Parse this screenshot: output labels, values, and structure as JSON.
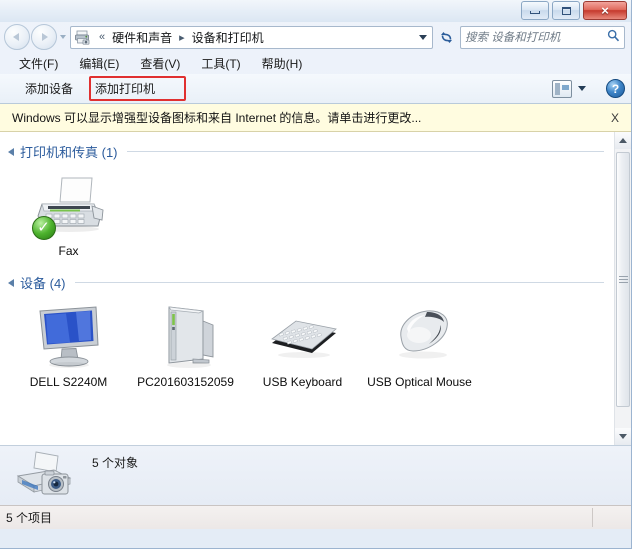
{
  "window": {
    "controls": {
      "minimize": "Minimize",
      "maximize": "Maximize",
      "close": "×"
    }
  },
  "address": {
    "icon": "printer-icon",
    "separator_first": "«",
    "separator": "▸",
    "crumbs": [
      "硬件和声音",
      "设备和打印机"
    ],
    "refresh_glyph": "↻",
    "dropdown": "chevron-down"
  },
  "search": {
    "placeholder": "搜索 设备和打印机",
    "value": "",
    "icon": "⚲"
  },
  "menubar": {
    "items": [
      {
        "label": "文件(F)"
      },
      {
        "label": "编辑(E)"
      },
      {
        "label": "查看(V)"
      },
      {
        "label": "工具(T)"
      },
      {
        "label": "帮助(H)"
      }
    ]
  },
  "toolbar": {
    "add_device_label": "添加设备",
    "add_printer_label": "添加打印机",
    "highlight_color": "#e03030",
    "help_glyph": "?"
  },
  "notification": {
    "message": "Windows 可以显示增强型设备图标和来自 Internet 的信息。请单击进行更改...",
    "close": "X",
    "background": "#fffce0"
  },
  "groups": [
    {
      "title": "打印机和传真 (1)",
      "items": [
        {
          "label": "Fax",
          "icon": "fax-machine-icon",
          "badge": "default-check-badge"
        }
      ]
    },
    {
      "title": "设备 (4)",
      "items": [
        {
          "label": "DELL S2240M",
          "icon": "monitor-icon",
          "badge": ""
        },
        {
          "label": "PC201603152059",
          "icon": "computer-tower-icon",
          "badge": ""
        },
        {
          "label": "USB Keyboard",
          "icon": "keyboard-icon",
          "badge": ""
        },
        {
          "label": "USB Optical Mouse",
          "icon": "mouse-icon",
          "badge": ""
        }
      ]
    }
  ],
  "details": {
    "icon": "printer-camera-icon",
    "text": "5 个对象"
  },
  "statusbar": {
    "text": "5 个项目"
  }
}
